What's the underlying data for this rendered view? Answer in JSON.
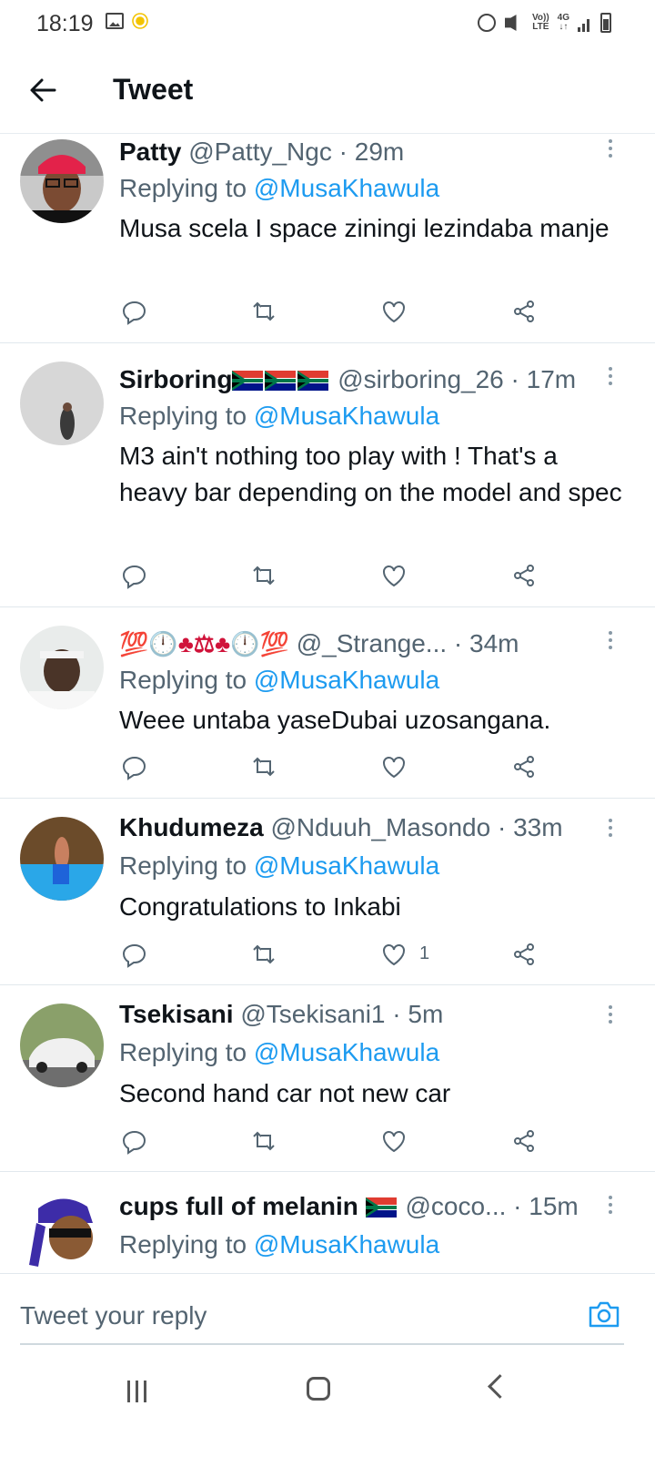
{
  "status": {
    "time": "18:19",
    "net_top": "Vo))",
    "net_bot": "LTE",
    "g_top": "4G",
    "g_bot": "↓↑"
  },
  "header": {
    "title": "Tweet"
  },
  "replies": [
    {
      "name": "Patty",
      "handle": "@Patty_Ngc",
      "time": "29m",
      "replying_prefix": "Replying to ",
      "mention": "@MusaKhawula",
      "text": "Musa scela I space ziningi lezindaba manje",
      "likes": ""
    },
    {
      "name": "Sirboring",
      "handle": "@sirboring_26",
      "time": "17m",
      "replying_prefix": "Replying to ",
      "mention": "@MusaKhawula",
      "text": "M3 ain't nothing too play with ! That's a heavy bar depending on the model and spec",
      "likes": ""
    },
    {
      "name": "💯🕛♣⚖♣🕛💯",
      "handle": "@_Strange...",
      "time": "34m",
      "replying_prefix": "Replying to ",
      "mention": "@MusaKhawula",
      "text": "Weee untaba yaseDubai uzosangana.",
      "likes": ""
    },
    {
      "name": "Khudumeza",
      "handle": "@Nduuh_Masondo",
      "time": "33m",
      "replying_prefix": "Replying to ",
      "mention": "@MusaKhawula",
      "text": "Congratulations to Inkabi",
      "likes": "1"
    },
    {
      "name": "Tsekisani",
      "handle": "@Tsekisani1",
      "time": "5m",
      "replying_prefix": "Replying to ",
      "mention": "@MusaKhawula",
      "text": "Second hand car not new car",
      "likes": ""
    },
    {
      "name": "cups full of melanin",
      "handle": "@coco...",
      "time": "15m",
      "replying_prefix": "Replying to ",
      "mention": "@MusaKhawula",
      "text": "",
      "likes": ""
    }
  ],
  "compose": {
    "placeholder": "Tweet your reply"
  },
  "icons": {
    "back": "arrow-left-icon",
    "reply": "comment-icon",
    "retweet": "retweet-icon",
    "like": "heart-icon",
    "share": "share-icon",
    "camera": "camera-icon"
  },
  "colors": {
    "accent": "#1d9bf0",
    "text": "#0f1419",
    "muted": "#536471"
  }
}
